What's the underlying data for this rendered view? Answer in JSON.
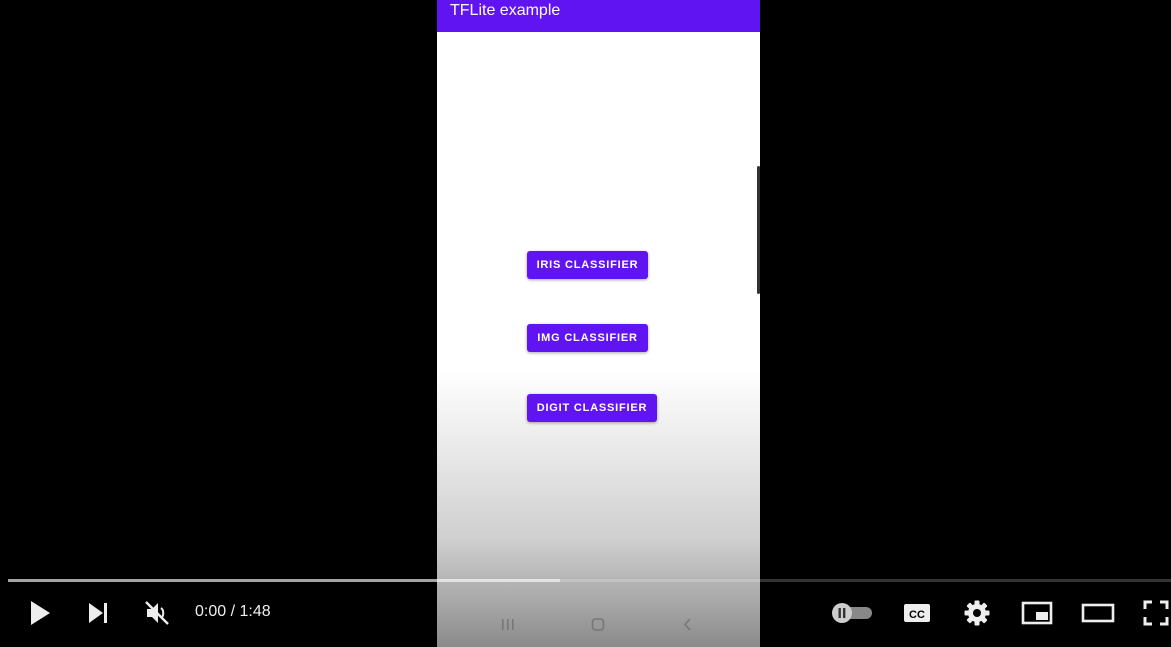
{
  "app": {
    "title": "TFLite example",
    "buttons": {
      "iris": "IRIS CLASSIFIER",
      "img": "IMG CLASSIFIER",
      "digit": "DIGIT CLASSIFIER"
    }
  },
  "player": {
    "current_time": "0:00",
    "separator": " / ",
    "duration": "1:48",
    "progress_fraction": 0.475,
    "autoplay": "paused-toggle",
    "muted": true
  },
  "icons": {
    "play": "play-icon",
    "next": "next-icon",
    "mute": "muted-volume-icon",
    "autoplay": "autoplay-toggle-icon",
    "cc": "closed-captions-icon",
    "settings": "gear-icon",
    "miniplayer": "miniplayer-icon",
    "theater": "theater-mode-icon",
    "fullscreen": "fullscreen-icon"
  },
  "colors": {
    "accent": "#6114f2",
    "controls": "#eeeeee"
  }
}
